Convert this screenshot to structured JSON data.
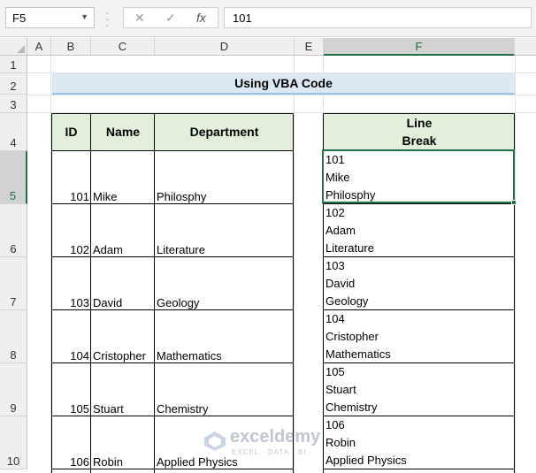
{
  "formula_bar": {
    "name_box": "F5",
    "formula": "101",
    "cancel_glyph": "✕",
    "enter_glyph": "✓",
    "fx_glyph": "fx"
  },
  "columns": [
    "A",
    "B",
    "C",
    "D",
    "E",
    "F"
  ],
  "rows": [
    "1",
    "2",
    "3",
    "4",
    "5",
    "6",
    "7",
    "8",
    "9",
    "10"
  ],
  "selected_cell": {
    "column": "F",
    "row": "5"
  },
  "title": "Using VBA Code",
  "table": {
    "headers": {
      "id": "ID",
      "name": "Name",
      "department": "Department"
    },
    "rows": [
      {
        "id": "101",
        "name": "Mike",
        "department": "Philosphy"
      },
      {
        "id": "102",
        "name": "Adam",
        "department": "Literature"
      },
      {
        "id": "103",
        "name": "David",
        "department": "Geology"
      },
      {
        "id": "104",
        "name": "Cristopher",
        "department": "Mathematics"
      },
      {
        "id": "105",
        "name": "Stuart",
        "department": "Chemistry"
      },
      {
        "id": "106",
        "name": "Robin",
        "department": "Applied Physics"
      }
    ]
  },
  "line_break": {
    "header_line1": "Line",
    "header_line2": "Break",
    "cells": [
      [
        "101",
        "Mike",
        "Philosphy"
      ],
      [
        "102",
        "Adam",
        "Literature"
      ],
      [
        "103",
        "David",
        "Geology"
      ],
      [
        "104",
        "Cristopher",
        "Mathematics"
      ],
      [
        "105",
        "Stuart",
        "Chemistry"
      ],
      [
        "106",
        "Robin",
        "Applied Physics"
      ]
    ]
  },
  "watermark": {
    "brand": "exceldemy",
    "tagline": "EXCEL · DATA · BI"
  },
  "colors": {
    "selection": "#217346",
    "title_fill": "#dce9f5",
    "header_fill": "#e2efda"
  }
}
